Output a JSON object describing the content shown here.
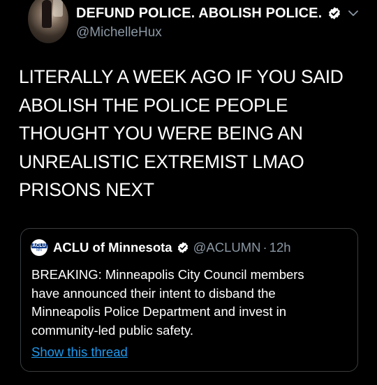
{
  "tweet": {
    "display_name": "DEFUND POLICE. ABOLISH POLICE.",
    "handle": "@MichelleHux",
    "text_lines": [
      "LITERALLY A WEEK AGO IF YOU SAID",
      "ABOLISH THE POLICE PEOPLE",
      "THOUGHT YOU WERE BEING AN",
      "UNREALISTIC EXTREMIST LMAO",
      "PRISONS NEXT"
    ],
    "avatar_icon": "profile-photo",
    "verified_icon": "verified-badge-icon",
    "menu_icon": "chevron-down-icon"
  },
  "quote": {
    "logo_text_top": "ACLU",
    "logo_text_bottom": "MN",
    "name": "ACLU of Minnesota",
    "handle": "@ACLUMN",
    "separator": "·",
    "time": "12h",
    "text_lines": [
      "BREAKING: Minneapolis City Council members",
      "have announced their intent to disband the",
      "Minneapolis Police Department and invest in",
      "community-led public safety."
    ],
    "show_thread": "Show this thread"
  },
  "colors": {
    "background": "#000000",
    "text": "#ffffff",
    "secondary_text": "#8b98a5",
    "link": "#1d9bf0",
    "border": "#3a3d40"
  }
}
